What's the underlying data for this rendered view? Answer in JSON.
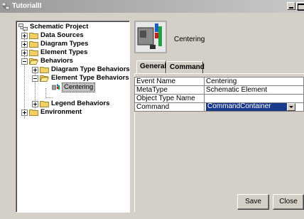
{
  "window": {
    "title": "TutorialII"
  },
  "tree": {
    "root": "Schematic Project",
    "items": [
      {
        "label": "Data Sources"
      },
      {
        "label": "Diagram Types"
      },
      {
        "label": "Element Types"
      },
      {
        "label": "Behaviors"
      },
      {
        "label": "Diagram Type Behaviors"
      },
      {
        "label": "Element Type Behaviors"
      },
      {
        "label": "Centering"
      },
      {
        "label": "Legend Behaviors"
      },
      {
        "label": "Environment"
      }
    ]
  },
  "header": {
    "title": "Centering"
  },
  "tabs": [
    {
      "label": "General"
    },
    {
      "label": "Command"
    }
  ],
  "properties": [
    {
      "key": "Event Name",
      "value": "Centering"
    },
    {
      "key": "MetaType",
      "value": "Schematic Element"
    },
    {
      "key": "Object Type Name",
      "value": ""
    },
    {
      "key": "Command",
      "value": "CommandContainer"
    }
  ],
  "buttons": {
    "save": "Save",
    "close": "Close"
  },
  "colors": {
    "selection": "#1a3a8a",
    "dialog_bg": "#d4d0c8"
  }
}
